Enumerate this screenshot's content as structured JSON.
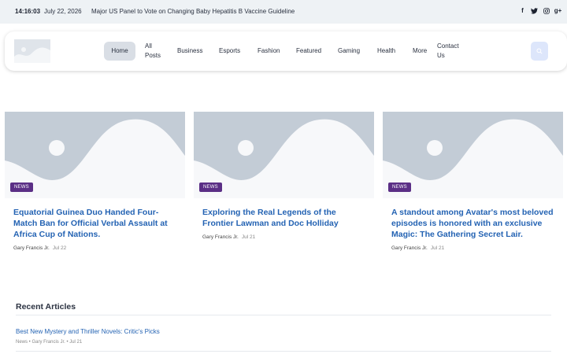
{
  "topbar": {
    "time": "14:16:03",
    "date": "July 22, 2026",
    "ticker": "Major US Panel to Vote on Changing Baby Hepatitis B Vaccine Guideline",
    "social": [
      {
        "icon": "facebook-icon",
        "glyph": "f"
      },
      {
        "icon": "twitter-icon",
        "glyph": "t"
      },
      {
        "icon": "instagram-icon",
        "glyph": "◎"
      },
      {
        "icon": "google-plus-icon",
        "glyph": "g+"
      }
    ]
  },
  "nav": {
    "home": "Home",
    "all_posts": "All Posts",
    "business": "Business",
    "esports": "Esports",
    "fashion": "Fashion",
    "featured": "Featured",
    "gaming": "Gaming",
    "health": "Health",
    "more": "More",
    "contact_us": "Contact Us"
  },
  "cards": [
    {
      "badge": "NEWS",
      "title": "Equatorial Guinea Duo Handed Four-Match Ban for Official Verbal Assault at Africa Cup of Nations.",
      "author": "Gary Francis Jr.",
      "date": "Jul 22"
    },
    {
      "badge": "NEWS",
      "title": "Exploring the Real Legends of the Frontier Lawman and Doc Holliday",
      "author": "Gary Francis Jr.",
      "date": "Jul 21"
    },
    {
      "badge": "NEWS",
      "title": "A standout among Avatar's most beloved episodes is honored with an exclusive Magic: The Gathering Secret Lair.",
      "author": "Gary Francis Jr.",
      "date": "Jul 21"
    }
  ],
  "recent": {
    "heading": "Recent Articles",
    "items": [
      {
        "title": "Best New Mystery and Thriller Novels: Critic's Picks",
        "meta": "News • Gary Francis Jr. • Jul 21"
      }
    ]
  },
  "colors": {
    "accent_link": "#2463b3",
    "badge": "#5b2f86",
    "placeholder": "#c3ccd6"
  }
}
